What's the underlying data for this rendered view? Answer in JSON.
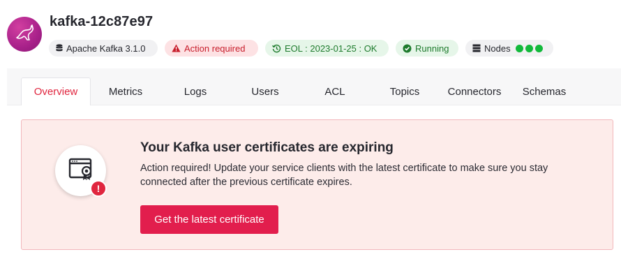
{
  "service": {
    "name": "kafka-12c87e97",
    "logo_icon": "kafka-kangaroo-icon"
  },
  "badges": {
    "version": {
      "label": "Apache Kafka 3.1.0",
      "icon": "database-icon"
    },
    "action": {
      "label": "Action required",
      "icon": "warning-triangle-icon",
      "color": "#c81d2b"
    },
    "eol": {
      "label": "EOL : 2023-01-25 : OK",
      "icon": "history-icon",
      "color": "#1e7b2d"
    },
    "status": {
      "label": "Running",
      "icon": "check-circle-icon",
      "color": "#1e7b2d"
    },
    "nodes": {
      "label": "Nodes",
      "icon": "server-icon",
      "count": 3,
      "color": "#12b93b"
    }
  },
  "tabs": [
    {
      "label": "Overview",
      "active": true
    },
    {
      "label": "Metrics"
    },
    {
      "label": "Logs"
    },
    {
      "label": "Users"
    },
    {
      "label": "ACL"
    },
    {
      "label": "Topics"
    },
    {
      "label": "Connectors"
    },
    {
      "label": "Schemas"
    }
  ],
  "alert": {
    "title": "Your Kafka user certificates are expiring",
    "text": "Action required! Update your service clients with the latest certificate to make sure you stay connected after the previous certificate expires.",
    "button": "Get the latest certificate",
    "icon": "certificate-icon",
    "badge_icon": "exclamation-icon",
    "badge_text": "!",
    "accent": "#e21e4d"
  }
}
